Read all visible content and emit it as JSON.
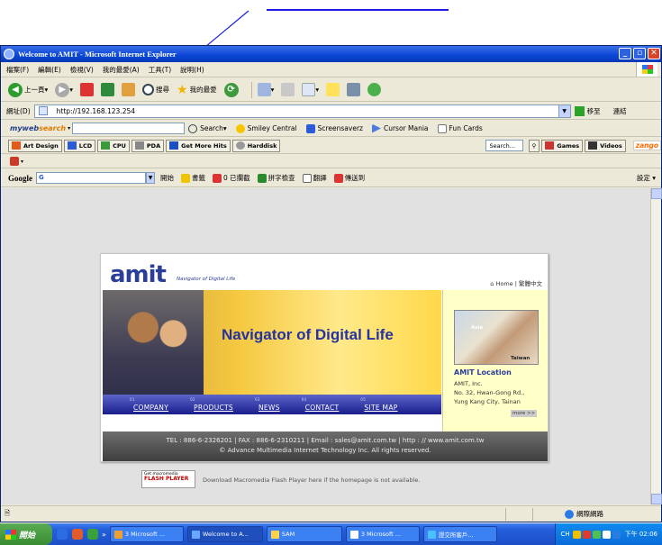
{
  "annotation": {
    "color": "#1e1ee6"
  },
  "window": {
    "title": "Welcome to AMIT - Microsoft Internet Explorer",
    "controls": {
      "minimize": "_",
      "maximize": "▫",
      "close": "✕"
    }
  },
  "menu": [
    "檔案(F)",
    "編輯(E)",
    "檢視(V)",
    "我的最愛(A)",
    "工具(T)",
    "說明(H)"
  ],
  "toolbar": {
    "back": "上一頁",
    "search": "搜尋",
    "favorites": "我的最愛"
  },
  "address": {
    "label": "網址(D)",
    "value": "http://192.168.123.254",
    "go": "移至",
    "links": "連結"
  },
  "mywebsearch": {
    "logo_a": "myweb",
    "logo_b": "search",
    "search": "Search",
    "items": [
      "Smiley Central",
      "Screensaverz",
      "Cursor Mania",
      "Fun Cards"
    ]
  },
  "links_bar": {
    "items": [
      "Art Design",
      "LCD",
      "CPU",
      "PDA",
      "Get More Hits",
      "Harddisk"
    ],
    "search_placeholder": "Search...",
    "games": "Games",
    "videos": "Videos",
    "zango": "zango"
  },
  "google_bar": {
    "logo": "Google",
    "input": "G",
    "items": [
      "開始",
      "書籤",
      "0 已攔截",
      "拼字檢查",
      "翻譯",
      "傳送到"
    ],
    "settings": "設定"
  },
  "amit": {
    "logo": "amit",
    "slogan": "Navigator of Digital Life",
    "home": "Home | 繁體中文",
    "hero_title": "Navigator of Digital Life",
    "nav": [
      {
        "num": "01",
        "label": "COMPANY"
      },
      {
        "num": "02",
        "label": "PRODUCTS"
      },
      {
        "num": "03",
        "label": "NEWS"
      },
      {
        "num": "04",
        "label": "CONTACT"
      },
      {
        "num": "05",
        "label": "SITE MAP"
      }
    ],
    "location": {
      "map_labels": [
        "Asia",
        "Taiwan"
      ],
      "title": "AMIT Location",
      "lines": [
        "AMIT, Inc.",
        "No. 32, Hwan-Gong Rd.,",
        "Yung Kang City, Tainan"
      ],
      "more": "more >>"
    },
    "footer": {
      "line1": "TEL : 886-6-2326201 | FAX : 886-6-2310211 | Email : sales@amit.com.tw | http : // www.amit.com.tw",
      "line2": "© Advance Multimedia Internet Technology Inc. All rights reserved."
    }
  },
  "flash": {
    "badge_top": "Get macromedia",
    "badge_bottom": "FLASH PLAYER",
    "text": "Download Macromedia Flash Player here if the homepage is not available."
  },
  "status": {
    "zone": "網際網路"
  },
  "taskbar": {
    "start": "開始",
    "tasks": [
      "3 Microsoft ...",
      "Welcome to A...",
      "SAM",
      "3 Microsoft ...",
      "證交所客戶..."
    ],
    "lang": "CH",
    "clock": "下午 02:06"
  }
}
